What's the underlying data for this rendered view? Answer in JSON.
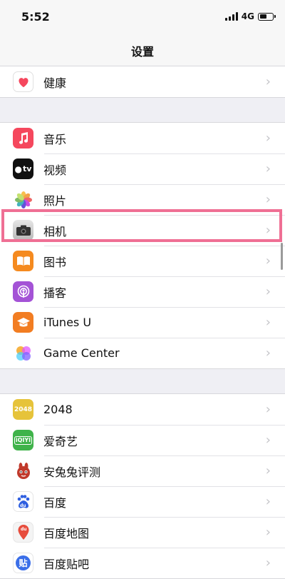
{
  "status_bar": {
    "time": "5:52",
    "network": "4G"
  },
  "nav": {
    "title": "设置"
  },
  "groups": [
    {
      "items": [
        {
          "label": "健康",
          "icon": "health-icon"
        }
      ]
    },
    {
      "items": [
        {
          "label": "音乐",
          "icon": "music-icon"
        },
        {
          "label": "视频",
          "icon": "apple-tv-icon",
          "icon_text": "tv"
        },
        {
          "label": "照片",
          "icon": "photos-icon"
        },
        {
          "label": "相机",
          "icon": "camera-icon"
        },
        {
          "label": "图书",
          "icon": "books-icon"
        },
        {
          "label": "播客",
          "icon": "podcasts-icon"
        },
        {
          "label": "iTunes U",
          "icon": "itunes-u-icon"
        },
        {
          "label": "Game Center",
          "icon": "game-center-icon"
        }
      ]
    },
    {
      "items": [
        {
          "label": "2048",
          "icon": "game-2048-icon",
          "icon_text": "2048"
        },
        {
          "label": "爱奇艺",
          "icon": "iqiyi-icon",
          "icon_text": "iQIYI"
        },
        {
          "label": "安兔兔评测",
          "icon": "antutu-icon"
        },
        {
          "label": "百度",
          "icon": "baidu-icon",
          "icon_text": "du"
        },
        {
          "label": "百度地图",
          "icon": "baidu-map-icon",
          "icon_text": "du"
        },
        {
          "label": "百度贴吧",
          "icon": "baidu-tieba-icon",
          "icon_text": "贴"
        }
      ]
    }
  ],
  "colors": {
    "highlight": "#ef6f94",
    "music": "#f5475d",
    "books": "#f58a1f",
    "podcasts": "#a453d6",
    "itunes_u": "#f27d22",
    "game_2048": "#e6c33a",
    "iqiyi": "#3fb34a",
    "baidu": "#2f5fe0",
    "tieba": "#3a6ee8"
  }
}
